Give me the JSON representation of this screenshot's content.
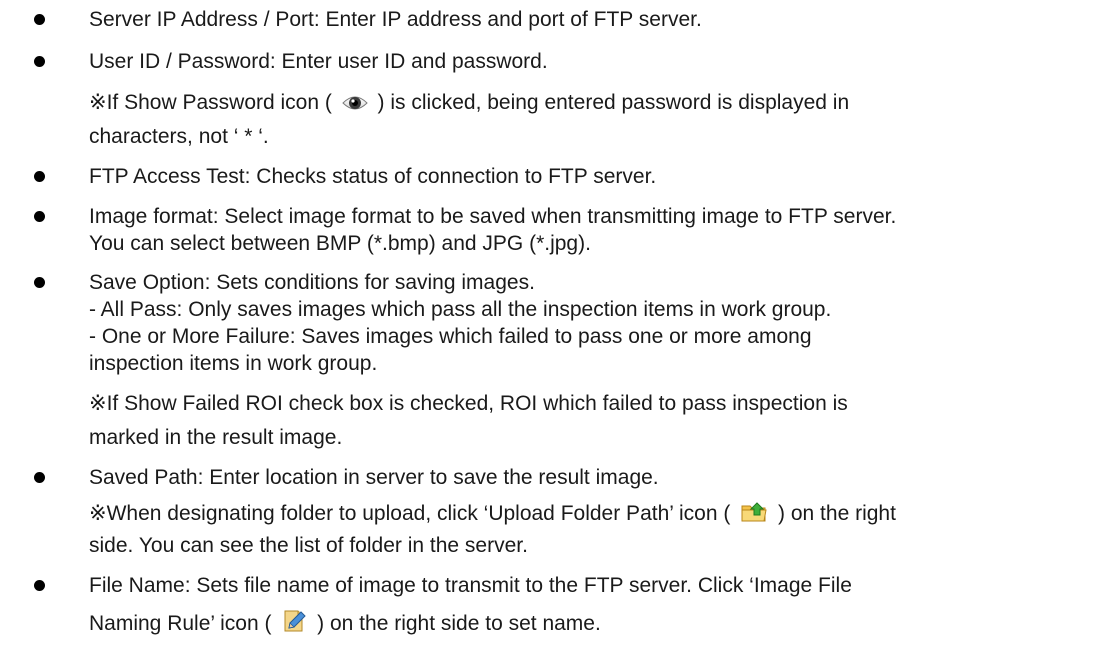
{
  "items": [
    {
      "id": "server-ip",
      "lines": [
        "Server IP Address / Port: Enter IP address and port of FTP server."
      ]
    },
    {
      "id": "user-id",
      "lines": [
        "User ID / Password: Enter user ID and password."
      ],
      "note_pre": "※If Show Password icon (",
      "note_post": ") is clicked, being entered password is displayed in",
      "note_line2": "characters, not ‘ * ‘.",
      "icon": "eye-icon"
    },
    {
      "id": "ftp-test",
      "lines": [
        "FTP Access Test: Checks status of connection to FTP server."
      ]
    },
    {
      "id": "image-format",
      "lines": [
        "Image format: Select image format to be saved when transmitting image to FTP server.",
        "You can select between BMP (*.bmp) and JPG (*.jpg)."
      ]
    },
    {
      "id": "save-option",
      "lines": [
        "Save Option: Sets conditions for saving images.",
        "- All Pass: Only saves images which pass all the inspection items in work group.",
        "- One or More Failure: Saves images which failed to pass one or more among",
        "inspection items in work group."
      ],
      "notes": [
        "※If Show Failed ROI check box is checked, ROI which failed to pass inspection is",
        "marked in the result image."
      ]
    },
    {
      "id": "saved-path",
      "lines": [
        "Saved Path: Enter location in server to save the result image."
      ],
      "note_pre": "※When designating folder to upload, click ‘Upload Folder Path’ icon (",
      "note_post": ") on the right",
      "note_line2": "side. You can see the list of folder in the server.",
      "icon": "upload-folder-icon"
    },
    {
      "id": "file-name",
      "lines": [
        "File Name: Sets file name of image to transmit to the FTP server. Click ‘Image File"
      ],
      "line2_pre": "Naming Rule’ icon (",
      "line2_post": ") on the right side to set name.",
      "icon": "file-naming-icon"
    }
  ]
}
